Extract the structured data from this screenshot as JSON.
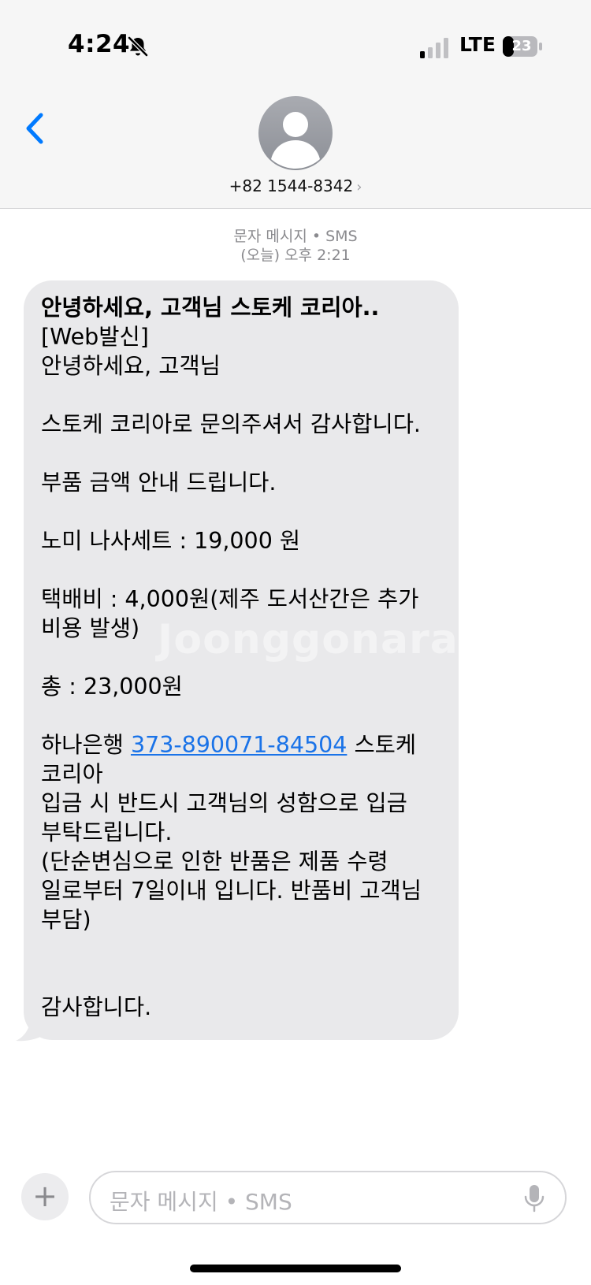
{
  "status_bar": {
    "time": "4:24",
    "network": "LTE",
    "battery": "23"
  },
  "header": {
    "contact_number": "+82 1544-8342",
    "contact_chevron": "›"
  },
  "message_meta": {
    "channel": "문자 메시지 • SMS",
    "timestamp": "(오늘) 오후 2:21"
  },
  "message": {
    "title": "안녕하세요, 고객님 스토케 코리아..",
    "line_web": "[Web발신]",
    "line_greeting": "안녕하세요, 고객님",
    "line_thanks": "스토케 코리아로 문의주셔서 감사합니다.",
    "line_parts": "부품 금액 안내 드립니다.",
    "line_item": "노미 나사세트 : 19,000 원",
    "line_shipping_1": "택배비 : 4,000원(제주 도서산간은 추가",
    "line_shipping_2": "비용 발생)",
    "line_total": "총 : 23,000원",
    "line_bank_prefix": "하나은행 ",
    "account_number": "373-890071-84504",
    "line_bank_suffix": " 스토케",
    "line_bank_2": "코리아",
    "line_deposit_1": "입금 시 반드시 고객님의 성함으로 입금",
    "line_deposit_2": "부탁드립니다.",
    "line_return_1": "(단순변심으로 인한 반품은 제품 수령",
    "line_return_2": "일로부터 7일이내 입니다. 반품비 고객님",
    "line_return_3": "부담)",
    "line_closing": "감사합니다."
  },
  "watermark": "Joonggonara",
  "composer": {
    "plus_label": "+",
    "placeholder": "문자 메시지 • SMS"
  },
  "icons": {
    "back": "chevron-left-icon",
    "bell": "bell-slash-icon",
    "mic": "microphone-icon"
  },
  "colors": {
    "accent": "#007aff",
    "bubble": "#e9e9eb",
    "link": "#1a73e8"
  }
}
